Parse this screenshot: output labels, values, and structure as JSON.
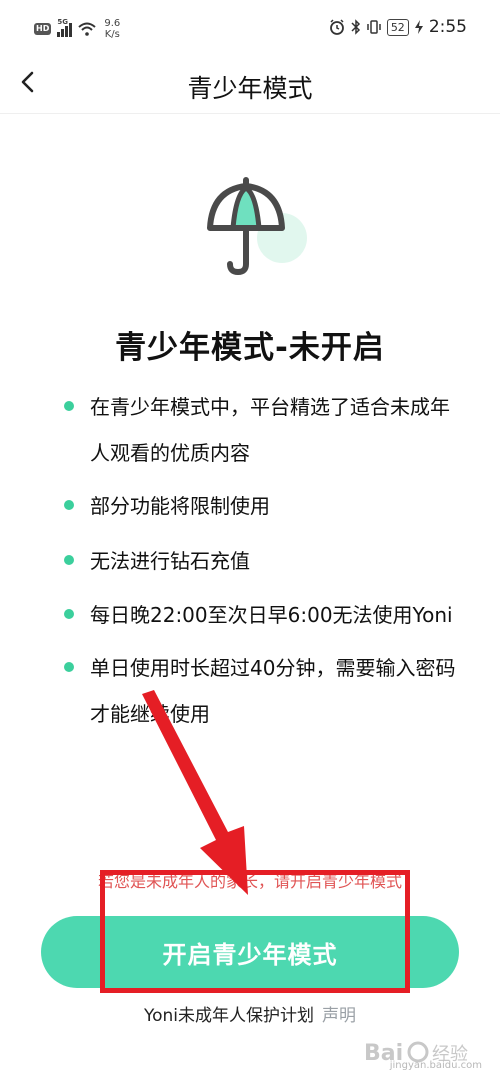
{
  "status_bar": {
    "hd": "HD",
    "network": "5G",
    "speed_value": "9.6",
    "speed_unit": "K/s",
    "battery": "52",
    "time": "2:55"
  },
  "nav": {
    "title": "青少年模式"
  },
  "main": {
    "title": "青少年模式-未开启",
    "features": [
      "在青少年模式中，平台精选了适合未成年人观看的优质内容",
      "部分功能将限制使用",
      "无法进行钻石充值",
      "每日晚22:00至次日早6:00无法使用Yoni",
      "单日使用时长超过40分钟，需要输入密码才能继续使用"
    ],
    "parent_tip": "若您是未成年人的家长，请开启青少年模式",
    "enable_button": "开启青少年模式"
  },
  "footer": {
    "plan_link": "Yoni未成年人保护计划",
    "declare_link": "声明"
  },
  "watermark": {
    "site": "jingyan.baidu.com"
  },
  "colors": {
    "accent": "#4dd8b0",
    "bullet": "#3bcf9c",
    "tip_red": "#e05555",
    "annotation_red": "#e51e25"
  }
}
